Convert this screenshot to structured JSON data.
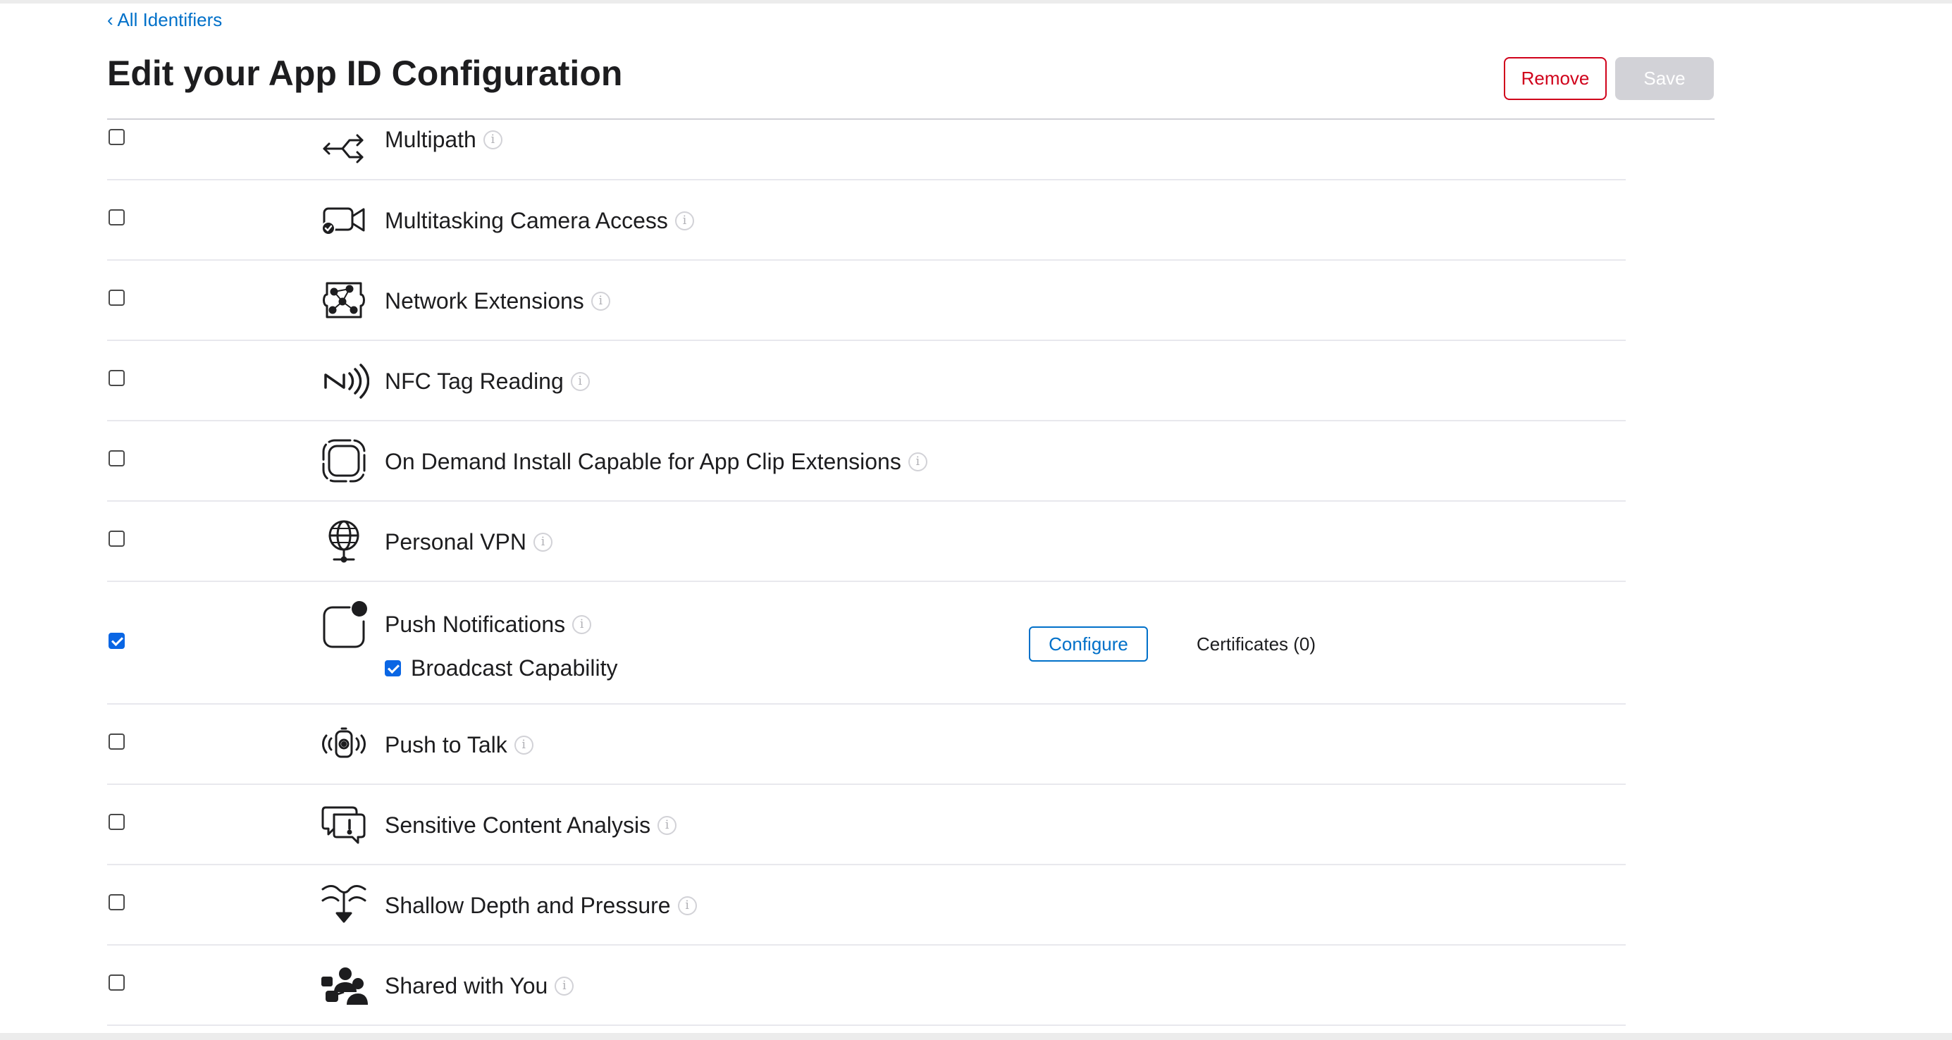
{
  "header": {
    "back_link": "‹ All Identifiers",
    "title": "Edit your App ID Configuration",
    "remove_label": "Remove",
    "save_label": "Save"
  },
  "capabilities": [
    {
      "name": "Multipath",
      "icon": "multipath-icon",
      "checked": false,
      "info": true
    },
    {
      "name": "Multitasking Camera Access",
      "icon": "camera-access-icon",
      "checked": false,
      "info": true
    },
    {
      "name": "Network Extensions",
      "icon": "network-extensions-icon",
      "checked": false,
      "info": true
    },
    {
      "name": "NFC Tag Reading",
      "icon": "nfc-icon",
      "checked": false,
      "info": true
    },
    {
      "name": "On Demand Install Capable for App Clip Extensions",
      "icon": "app-clip-icon",
      "checked": false,
      "info": true
    },
    {
      "name": "Personal VPN",
      "icon": "globe-icon",
      "checked": false,
      "info": true
    },
    {
      "name": "Push Notifications",
      "icon": "push-notification-icon",
      "checked": true,
      "info": true,
      "sub_option": {
        "label": "Broadcast Capability",
        "checked": true
      },
      "configure_label": "Configure",
      "certificates_label": "Certificates (0)"
    },
    {
      "name": "Push to Talk",
      "icon": "push-to-talk-icon",
      "checked": false,
      "info": true
    },
    {
      "name": "Sensitive Content Analysis",
      "icon": "speech-bubble-alert-icon",
      "checked": false,
      "info": true
    },
    {
      "name": "Shallow Depth and Pressure",
      "icon": "depth-pressure-icon",
      "checked": false,
      "info": true
    },
    {
      "name": "Shared with You",
      "icon": "shared-people-icon",
      "checked": false,
      "info": true
    }
  ],
  "colors": {
    "link": "#0070c9",
    "remove": "#d0021b",
    "save_disabled": "#d2d2d7",
    "checkbox_checked": "#0a66e4",
    "divider": "#e8e8ed"
  }
}
